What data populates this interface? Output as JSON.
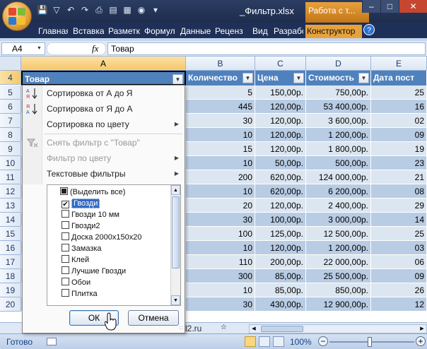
{
  "title": {
    "file": "_Фильтр.xlsx",
    "context_tab_title": "Работа с т...",
    "tabs": [
      "Главная",
      "Вставка",
      "Разметк",
      "Формул",
      "Данные",
      "Реценз",
      "Вид",
      "Разрабо",
      "Конструктор"
    ]
  },
  "formula_bar": {
    "name_box": "A4",
    "fx": "fx",
    "content": "Товар"
  },
  "columns": [
    "A",
    "B",
    "C",
    "D",
    "E"
  ],
  "rows": [
    "4",
    "5",
    "6",
    "7",
    "8",
    "9",
    "10",
    "11",
    "12",
    "13",
    "14",
    "15",
    "16",
    "17",
    "18",
    "19",
    "20"
  ],
  "table_headers": [
    "Товар",
    "Количество",
    "Цена",
    "Стоимость",
    "Дата пост"
  ],
  "table_rows": [
    {
      "qty": "5",
      "price": "150,00р.",
      "cost": "750,00р.",
      "date": "25"
    },
    {
      "qty": "445",
      "price": "120,00р.",
      "cost": "53 400,00р.",
      "date": "16"
    },
    {
      "qty": "30",
      "price": "120,00р.",
      "cost": "3 600,00р.",
      "date": "02"
    },
    {
      "qty": "10",
      "price": "120,00р.",
      "cost": "1 200,00р.",
      "date": "09"
    },
    {
      "qty": "15",
      "price": "120,00р.",
      "cost": "1 800,00р.",
      "date": "19"
    },
    {
      "qty": "10",
      "price": "50,00р.",
      "cost": "500,00р.",
      "date": "23"
    },
    {
      "qty": "200",
      "price": "620,00р.",
      "cost": "124 000,00р.",
      "date": "21"
    },
    {
      "qty": "10",
      "price": "620,00р.",
      "cost": "6 200,00р.",
      "date": "08"
    },
    {
      "qty": "20",
      "price": "120,00р.",
      "cost": "2 400,00р.",
      "date": "29"
    },
    {
      "qty": "30",
      "price": "100,00р.",
      "cost": "3 000,00р.",
      "date": "14"
    },
    {
      "qty": "100",
      "price": "125,00р.",
      "cost": "12 500,00р.",
      "date": "25"
    },
    {
      "qty": "10",
      "price": "120,00р.",
      "cost": "1 200,00р.",
      "date": "03"
    },
    {
      "qty": "110",
      "price": "200,00р.",
      "cost": "22 000,00р.",
      "date": "06"
    },
    {
      "qty": "300",
      "price": "85,00р.",
      "cost": "25 500,00р.",
      "date": "09"
    },
    {
      "qty": "10",
      "price": "85,00р.",
      "cost": "850,00р.",
      "date": "26"
    },
    {
      "qty": "30",
      "price": "430,00р.",
      "cost": "12 900,00р.",
      "date": "12"
    }
  ],
  "filter_menu": {
    "sort_az": "Сортировка от А до Я",
    "sort_za": "Сортировка от Я до А",
    "sort_color": "Сортировка по цвету",
    "clear_filter": "Снять фильтр с \"Товар\"",
    "filter_color": "Фильтр по цвету",
    "text_filters": "Текстовые фильтры",
    "items": [
      {
        "label": "(Выделить все)",
        "state": "mixed"
      },
      {
        "label": "Гвозди",
        "state": "checked"
      },
      {
        "label": "Гвозди 10 мм",
        "state": "unchecked"
      },
      {
        "label": "Гвозди2",
        "state": "unchecked"
      },
      {
        "label": "Доска 2000х150х20",
        "state": "unchecked"
      },
      {
        "label": "Замазка",
        "state": "unchecked"
      },
      {
        "label": "Клей",
        "state": "unchecked"
      },
      {
        "label": "Лучшие Гвозди",
        "state": "unchecked"
      },
      {
        "label": "Обои",
        "state": "unchecked"
      },
      {
        "label": "Плитка",
        "state": "unchecked"
      }
    ],
    "ok": "ОК",
    "cancel": "Отмена"
  },
  "sheet_tab_fragment": "l2.ru",
  "status": {
    "ready": "Готово",
    "zoom": "100%"
  },
  "colors": {
    "header_blue": "#4f81bd",
    "row_light": "#dce6f1",
    "row_dark": "#b8cce4",
    "selection_orange": "#f6c869"
  }
}
